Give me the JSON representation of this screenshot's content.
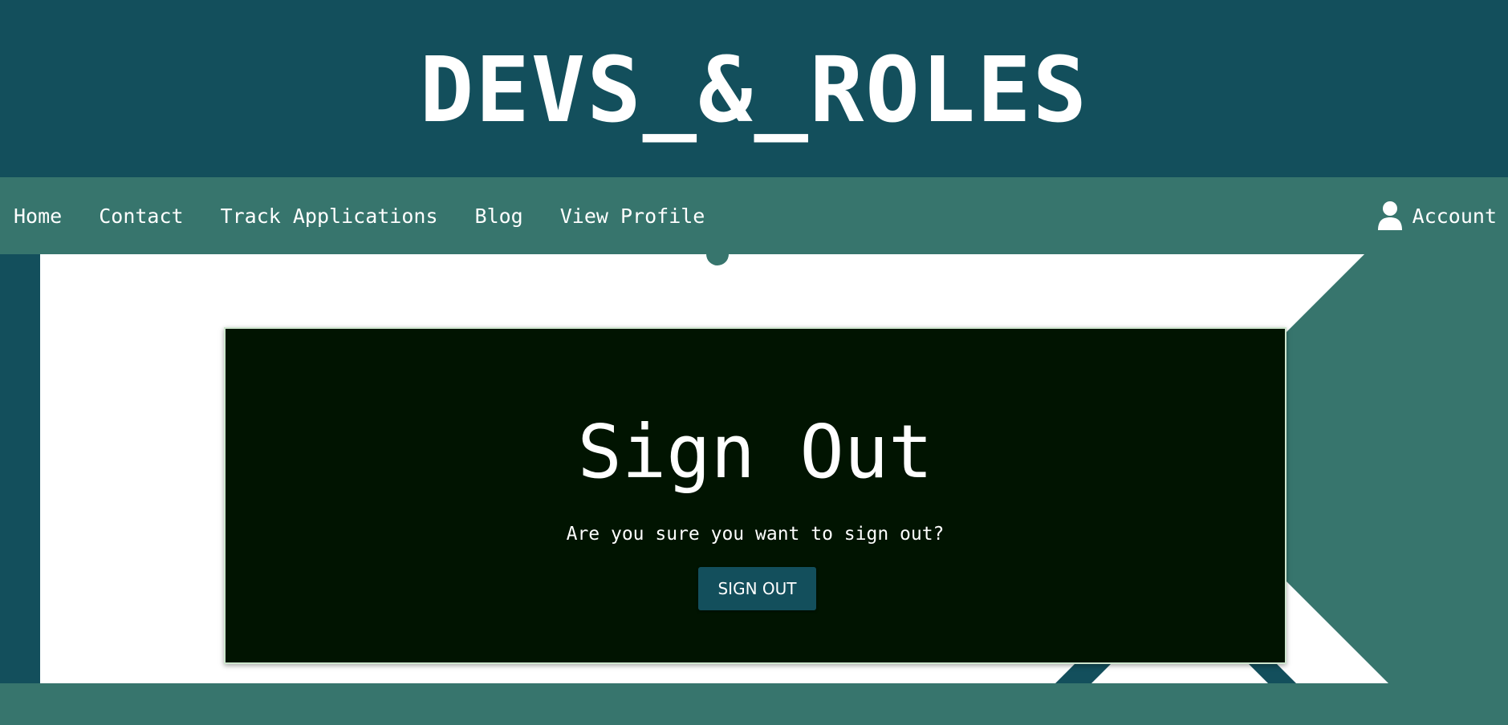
{
  "header": {
    "site_title": "DEVS_&_ROLES"
  },
  "nav": {
    "items": [
      {
        "label": "Home"
      },
      {
        "label": "Contact"
      },
      {
        "label": "Track Applications"
      },
      {
        "label": "Blog"
      },
      {
        "label": "View Profile"
      }
    ],
    "account_label": "Account",
    "account_icon": "user-icon"
  },
  "modal": {
    "title": "Sign Out",
    "message": "Are you sure you want to sign out?",
    "button_label": "SIGN OUT"
  },
  "colors": {
    "header_bg": "#134f5c",
    "nav_bg": "#37756d",
    "modal_bg": "#011401",
    "button_bg": "#134f5c",
    "text": "#ffffff"
  }
}
